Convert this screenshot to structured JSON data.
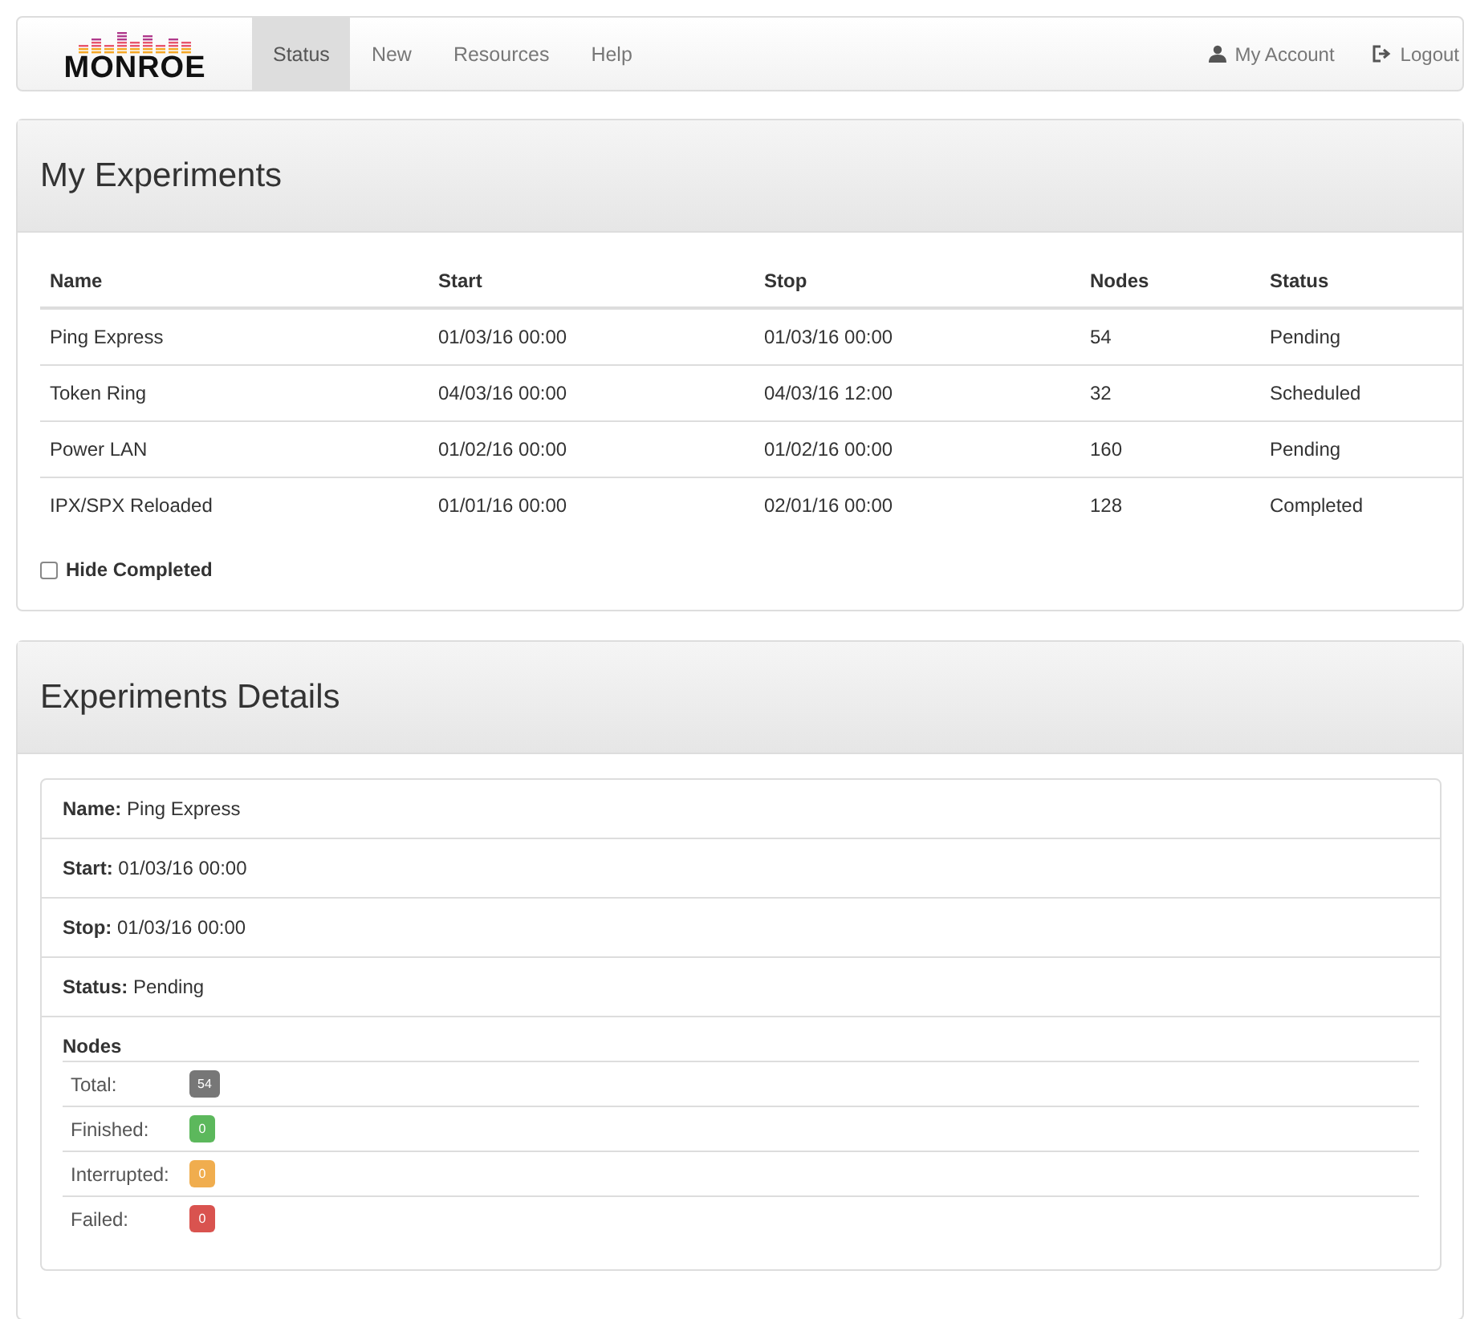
{
  "navbar": {
    "logo": "MONROE",
    "items": [
      {
        "label": "Status",
        "selected": true
      },
      {
        "label": "New",
        "selected": false
      },
      {
        "label": "Resources",
        "selected": false
      },
      {
        "label": "Help",
        "selected": false
      }
    ],
    "account": "My Account",
    "logout": "Logout"
  },
  "experiments": {
    "title": "My Experiments",
    "columns": [
      "Name",
      "Start",
      "Stop",
      "Nodes",
      "Status"
    ],
    "rows": [
      [
        "Ping Express",
        "01/03/16 00:00",
        "01/03/16 00:00",
        "54",
        "Pending"
      ],
      [
        "Token Ring",
        "04/03/16 00:00",
        "04/03/16 12:00",
        "32",
        "Scheduled"
      ],
      [
        "Power LAN",
        "01/02/16 00:00",
        "01/02/16 00:00",
        "160",
        "Pending"
      ],
      [
        "IPX/SPX Reloaded",
        "01/01/16 00:00",
        "02/01/16 00:00",
        "128",
        "Completed"
      ]
    ],
    "hide_completed": {
      "label": "Hide Completed",
      "checked": false
    }
  },
  "details": {
    "title": "Experiments Details",
    "fields": [
      {
        "label": "Name:",
        "value": "Ping Express"
      },
      {
        "label": "Start:",
        "value": "01/03/16 00:00"
      },
      {
        "label": "Stop:",
        "value": "01/03/16 00:00"
      },
      {
        "label": "Status:",
        "value": "Pending"
      }
    ],
    "nodes_title": "Nodes",
    "nodes": [
      {
        "label": "Total:",
        "count": "54",
        "color": "#777777"
      },
      {
        "label": "Finished:",
        "count": "0",
        "color": "#5cb85c"
      },
      {
        "label": "Interrupted:",
        "count": "0",
        "color": "#f0ad4e"
      },
      {
        "label": "Failed:",
        "count": "0",
        "color": "#d9534f"
      }
    ]
  }
}
